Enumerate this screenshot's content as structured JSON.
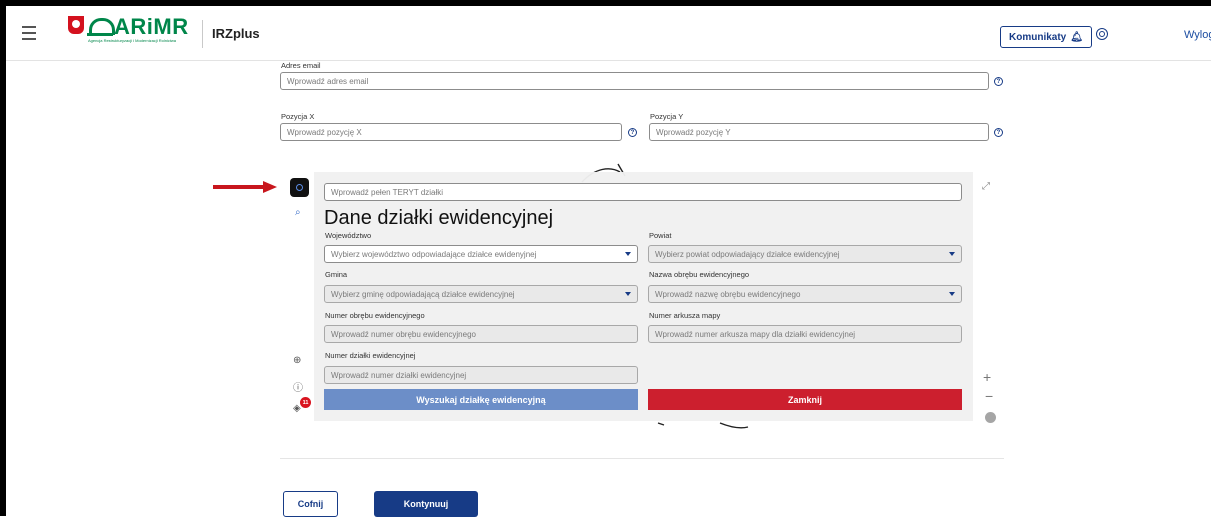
{
  "header": {
    "logo_text": "ARiMR",
    "logo_subtext": "Agencja Restrukturyzacji i Modernizacji Rolnictwa",
    "app_title": "IRZplus",
    "komunikaty_label": "Komunikaty",
    "logout_label": "Wyloguj"
  },
  "form": {
    "email": {
      "label": "Adres email",
      "placeholder": "Wprowadź adres email"
    },
    "pos_x": {
      "label": "Pozycja X",
      "placeholder": "Wprowadź pozycję X"
    },
    "pos_y": {
      "label": "Pozycja Y",
      "placeholder": "Wprowadź pozycję Y"
    }
  },
  "map": {
    "layers_badge_count": "11"
  },
  "panel": {
    "teryt_placeholder": "Wprowadź pełen TERYT działki",
    "title": "Dane działki ewidencyjnej",
    "wojewodztwo": {
      "label": "Województwo",
      "placeholder": "Wybierz województwo odpowiadające działce ewidenyjnej"
    },
    "powiat": {
      "label": "Powiat",
      "placeholder": "Wybierz powiat odpowiadający działce ewidencyjnej"
    },
    "gmina": {
      "label": "Gmina",
      "placeholder": "Wybierz gminę odpowiadającą działce ewidencyjnej"
    },
    "obreb_nazwa": {
      "label": "Nazwa obrębu ewidencyjnego",
      "placeholder": "Wprowadź nazwę obrębu ewidencyjnego"
    },
    "obreb_numer": {
      "label": "Numer obrębu ewidencyjnego",
      "placeholder": "Wprowadź numer obrębu ewidencyjnego"
    },
    "arkusz": {
      "label": "Numer arkusza mapy",
      "placeholder": "Wprowadź numer arkusza mapy dla działki ewidencyjnej"
    },
    "dzialka": {
      "label": "Numer działki ewidencyjnej",
      "placeholder": "Wprowadź numer działki ewidencyjnej"
    },
    "search_button": "Wyszukaj działkę ewidencyjną",
    "close_button": "Zamknij"
  },
  "footer": {
    "back_button": "Cofnij",
    "next_button": "Kontynuuj"
  },
  "colors": {
    "primary": "#173b86",
    "danger": "#cc1f2e",
    "search_button": "#6c8ec8",
    "logo_green": "#00864a"
  }
}
